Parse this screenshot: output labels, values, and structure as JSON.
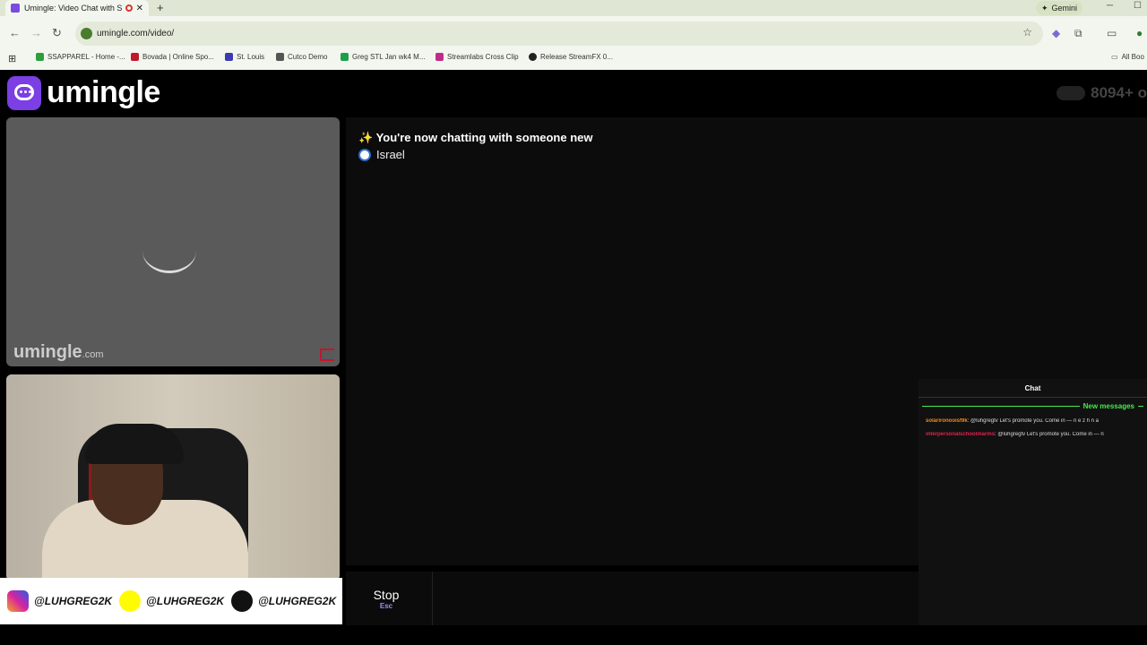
{
  "browser": {
    "tab_title": "Umingle: Video Chat with S",
    "new_tab": "+",
    "gemini_label": "Gemini",
    "url": "umingle.com/video/",
    "bookmarks": [
      {
        "label": "SSAPPAREL - Home -...",
        "color": "#2e9e3b"
      },
      {
        "label": "Bovada | Online Spo...",
        "color": "#c0192b"
      },
      {
        "label": "St. Louis",
        "color": "#3a3ab0"
      },
      {
        "label": "Cutco Demo",
        "color": "#555555"
      },
      {
        "label": "Greg STL Jan wk4 M...",
        "color": "#1e9e4a"
      },
      {
        "label": "Streamlabs Cross Clip",
        "color": "#c02a8a"
      },
      {
        "label": "Release StreamFX 0...",
        "color": "#222222"
      }
    ],
    "all_bookmarks": "All Boo"
  },
  "site": {
    "logo_text": "umingle",
    "online_count": "8094+ o",
    "watermark": "umingle",
    "watermark_suffix": ".com",
    "accent": "#7b3fe4"
  },
  "chat": {
    "notice": "✨ You're now chatting with someone new",
    "country": "Israel"
  },
  "controls": {
    "stop_label": "Stop",
    "stop_key": "Esc"
  },
  "social": [
    {
      "handle": "@LUHGREG2K",
      "icon": "instagram-icon"
    },
    {
      "handle": "@LUHGREG2K",
      "icon": "snapchat-icon"
    },
    {
      "handle": "@LUHGREG2K",
      "icon": "tiktok-icon"
    }
  ],
  "stream_chat": {
    "title": "Chat",
    "new_messages": "New messages",
    "messages": [
      {
        "user": "solarironooisf9k",
        "user_color": "#f08a24",
        "text": "@luhgregtv Let's promote you. Come in — n e z  h n a"
      },
      {
        "user": "interpersonalschoolmarms",
        "user_color": "#e0234a",
        "text": "@luhgregtv Let's promote you. Come in — n"
      }
    ]
  }
}
